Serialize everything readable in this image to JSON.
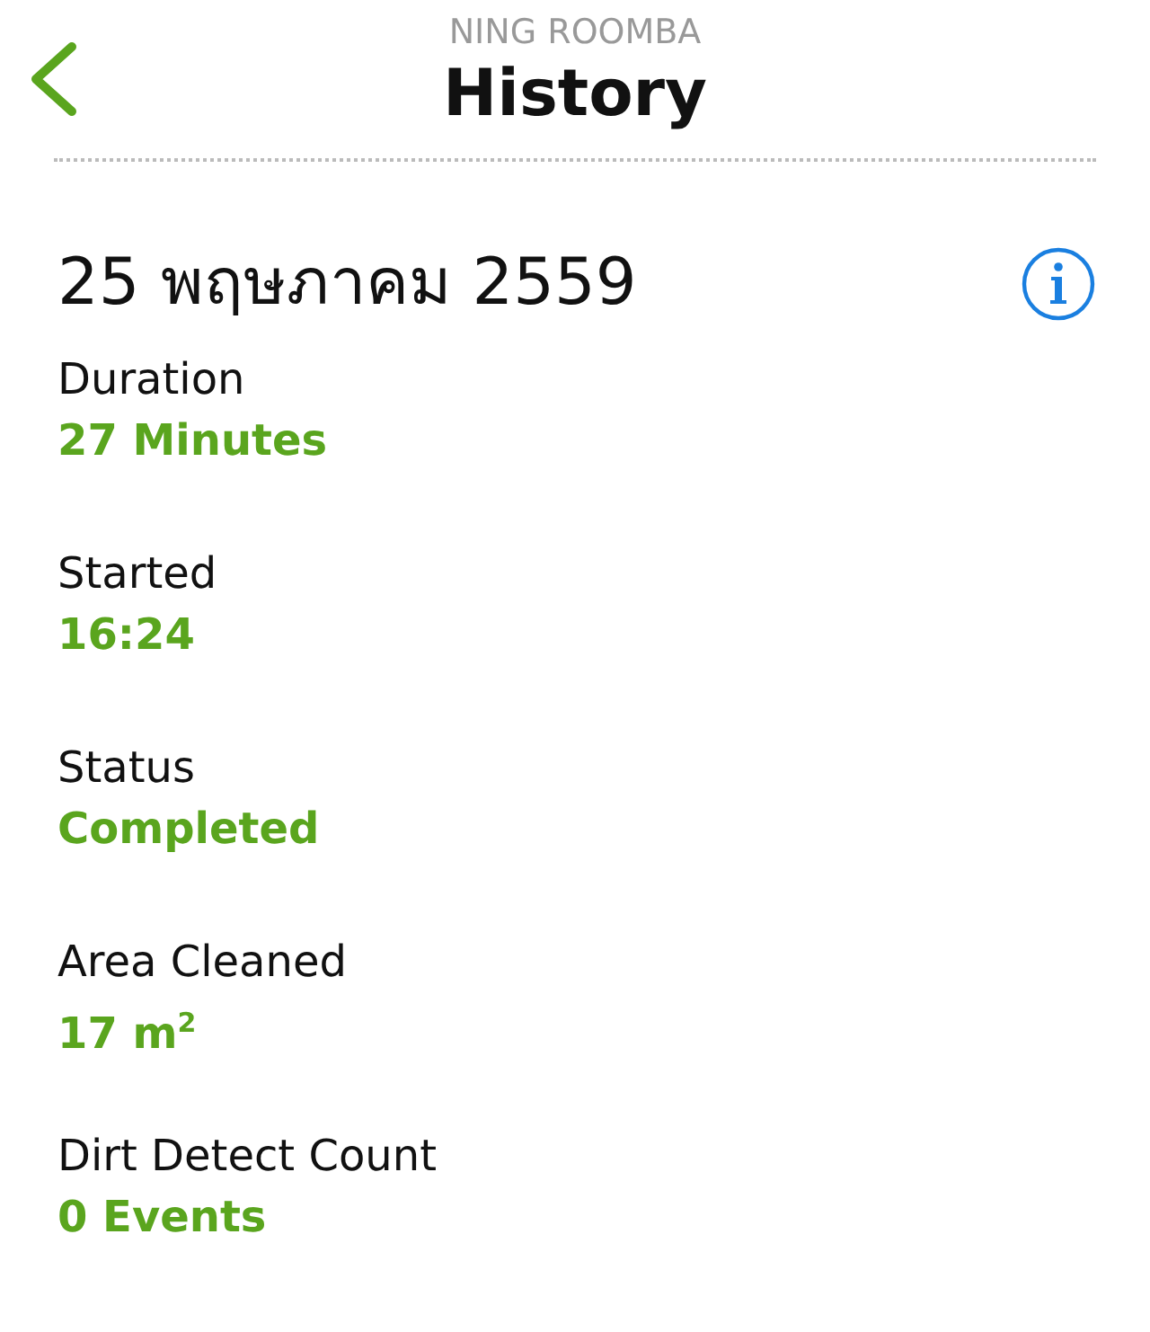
{
  "header": {
    "subtitle": "NING ROOMBA",
    "title": "History"
  },
  "date": "25 พฤษภาคม 2559",
  "details": [
    {
      "label": "Duration",
      "value": "27 Minutes"
    },
    {
      "label": "Started",
      "value": "16:24"
    },
    {
      "label": "Status",
      "value": "Completed"
    },
    {
      "label": "Area Cleaned",
      "value": "17 m$^{2}$"
    },
    {
      "label": "Dirt Detect Count",
      "value": "0 Events"
    }
  ]
}
